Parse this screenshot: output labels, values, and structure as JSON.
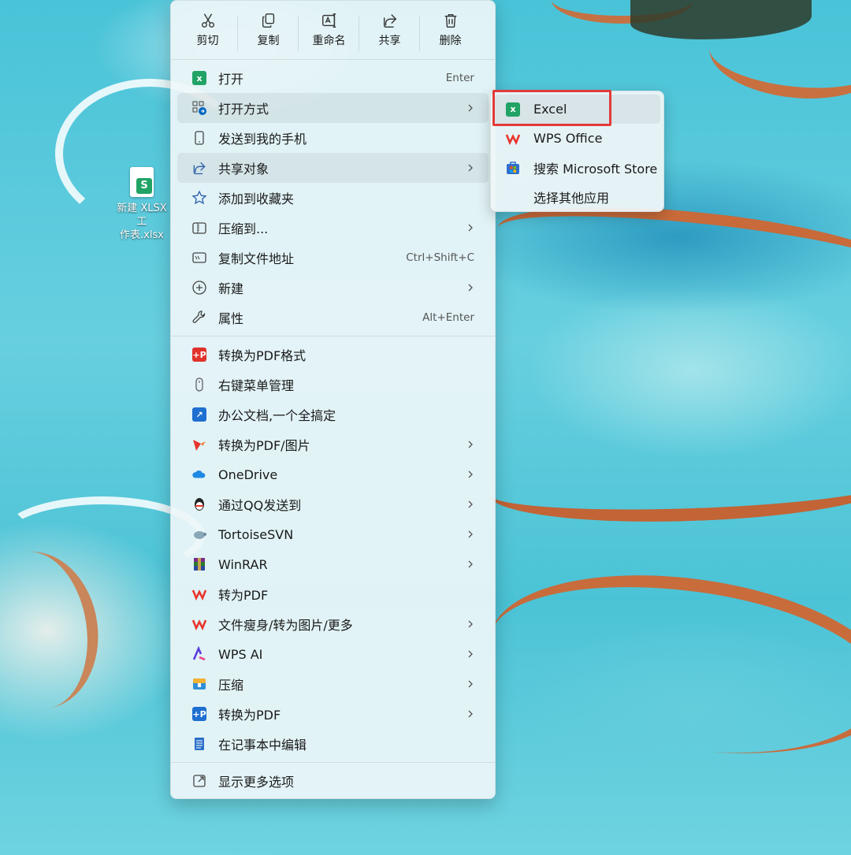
{
  "desktop": {
    "file_label": "新建 XLSX 工\n作表.xlsx",
    "file_badge": "S"
  },
  "toolbar": [
    {
      "label": "剪切",
      "icon": "cut-icon"
    },
    {
      "label": "复制",
      "icon": "copy-icon"
    },
    {
      "label": "重命名",
      "icon": "rename-icon"
    },
    {
      "label": "共享",
      "icon": "share-icon"
    },
    {
      "label": "删除",
      "icon": "delete-icon"
    }
  ],
  "menu": {
    "group1": [
      {
        "label": "打开",
        "shortcut": "Enter",
        "icon": "excel-icon"
      },
      {
        "label": "打开方式",
        "shortcut": "",
        "icon": "open-with-icon",
        "submenu": true,
        "highlighted": true
      },
      {
        "label": "发送到我的手机",
        "shortcut": "",
        "icon": "phone-icon"
      },
      {
        "label": "共享对象",
        "shortcut": "",
        "icon": "share-icon",
        "submenu": true,
        "highlighted": true
      },
      {
        "label": "添加到收藏夹",
        "shortcut": "",
        "icon": "star-icon"
      },
      {
        "label": "压缩到...",
        "shortcut": "",
        "icon": "zip-folder-icon",
        "submenu": true
      },
      {
        "label": "复制文件地址",
        "shortcut": "Ctrl+Shift+C",
        "icon": "path-icon"
      },
      {
        "label": "新建",
        "shortcut": "",
        "icon": "new-icon",
        "submenu": true
      },
      {
        "label": "属性",
        "shortcut": "Alt+Enter",
        "icon": "wrench-icon"
      }
    ],
    "group2": [
      {
        "label": "转换为PDF格式",
        "icon": "pdf-convert-icon",
        "submenu": false
      },
      {
        "label": "右键菜单管理",
        "icon": "mouse-icon",
        "submenu": false
      },
      {
        "label": "办公文档,一个全搞定",
        "icon": "office-doc-icon",
        "submenu": false
      },
      {
        "label": "转换为PDF/图片",
        "icon": "bird-icon",
        "submenu": true
      },
      {
        "label": "OneDrive",
        "icon": "onedrive-icon",
        "submenu": true
      },
      {
        "label": "通过QQ发送到",
        "icon": "qq-icon",
        "submenu": true
      },
      {
        "label": "TortoiseSVN",
        "icon": "tortoise-icon",
        "submenu": true
      },
      {
        "label": "WinRAR",
        "icon": "winrar-icon",
        "submenu": true
      },
      {
        "label": "转为PDF",
        "icon": "wps-icon",
        "submenu": false
      },
      {
        "label": "文件瘦身/转为图片/更多",
        "icon": "wps-icon",
        "submenu": true
      },
      {
        "label": "WPS AI",
        "icon": "wps-ai-icon",
        "submenu": true
      },
      {
        "label": "压缩",
        "icon": "compress-icon",
        "submenu": true
      },
      {
        "label": "转换为PDF",
        "icon": "pdf-p-icon",
        "submenu": true
      },
      {
        "label": "在记事本中编辑",
        "icon": "notepad-icon",
        "submenu": false
      }
    ],
    "group3": [
      {
        "label": "显示更多选项",
        "icon": "more-options-icon"
      }
    ]
  },
  "submenu": [
    {
      "label": "Excel",
      "icon": "excel-icon",
      "highlighted": true
    },
    {
      "label": "WPS Office",
      "icon": "wps-icon"
    },
    {
      "label": "搜索 Microsoft Store",
      "icon": "store-icon"
    },
    {
      "label": "选择其他应用",
      "icon": ""
    }
  ],
  "colors": {
    "excel_green": "#21a366",
    "wps_red": "#e8352d",
    "annotation_red": "#e23a3a",
    "accent_blue": "#0067c0"
  }
}
